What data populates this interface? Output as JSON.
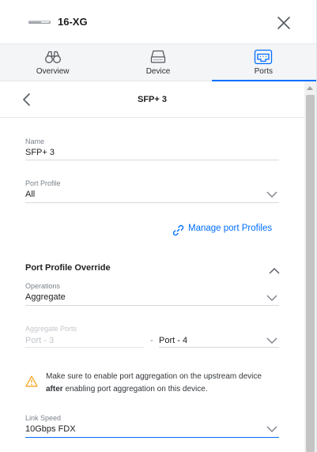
{
  "header": {
    "device_name": "16-XG",
    "device_thumbnail_icon": "switch-device-icon",
    "close_icon": "close-icon"
  },
  "tabs": [
    {
      "label": "Overview",
      "icon": "binoculars-icon",
      "active": false
    },
    {
      "label": "Device",
      "icon": "device-icon",
      "active": false
    },
    {
      "label": "Ports",
      "icon": "ports-icon",
      "active": true
    }
  ],
  "subheader": {
    "title": "SFP+ 3",
    "back_icon": "chevron-left-icon"
  },
  "form": {
    "name": {
      "label": "Name",
      "value": "SFP+ 3"
    },
    "port_profile": {
      "label": "Port Profile",
      "value": "All"
    },
    "manage_link": {
      "label": "Manage port Profiles",
      "icon": "link-icon"
    },
    "override": {
      "title": "Port Profile Override",
      "collapse_icon": "chevron-up-icon"
    },
    "operations": {
      "label": "Operations",
      "value": "Aggregate"
    },
    "aggregate_ports": {
      "label": "Aggregate Ports",
      "from_value": "Port - 3",
      "separator": "-",
      "to_value": "Port - 4"
    },
    "warning": {
      "icon": "warning-icon",
      "text_part1": "Make sure to enable port aggregation on the upstream device",
      "text_bold": "after",
      "text_part2": " enabling port aggregation on this device."
    },
    "link_speed": {
      "label": "Link Speed",
      "value": "10Gbps FDX"
    }
  },
  "colors": {
    "accent": "#006fff",
    "warning": "#f5a623",
    "tab_bar_bg": "#f4f5f6"
  }
}
